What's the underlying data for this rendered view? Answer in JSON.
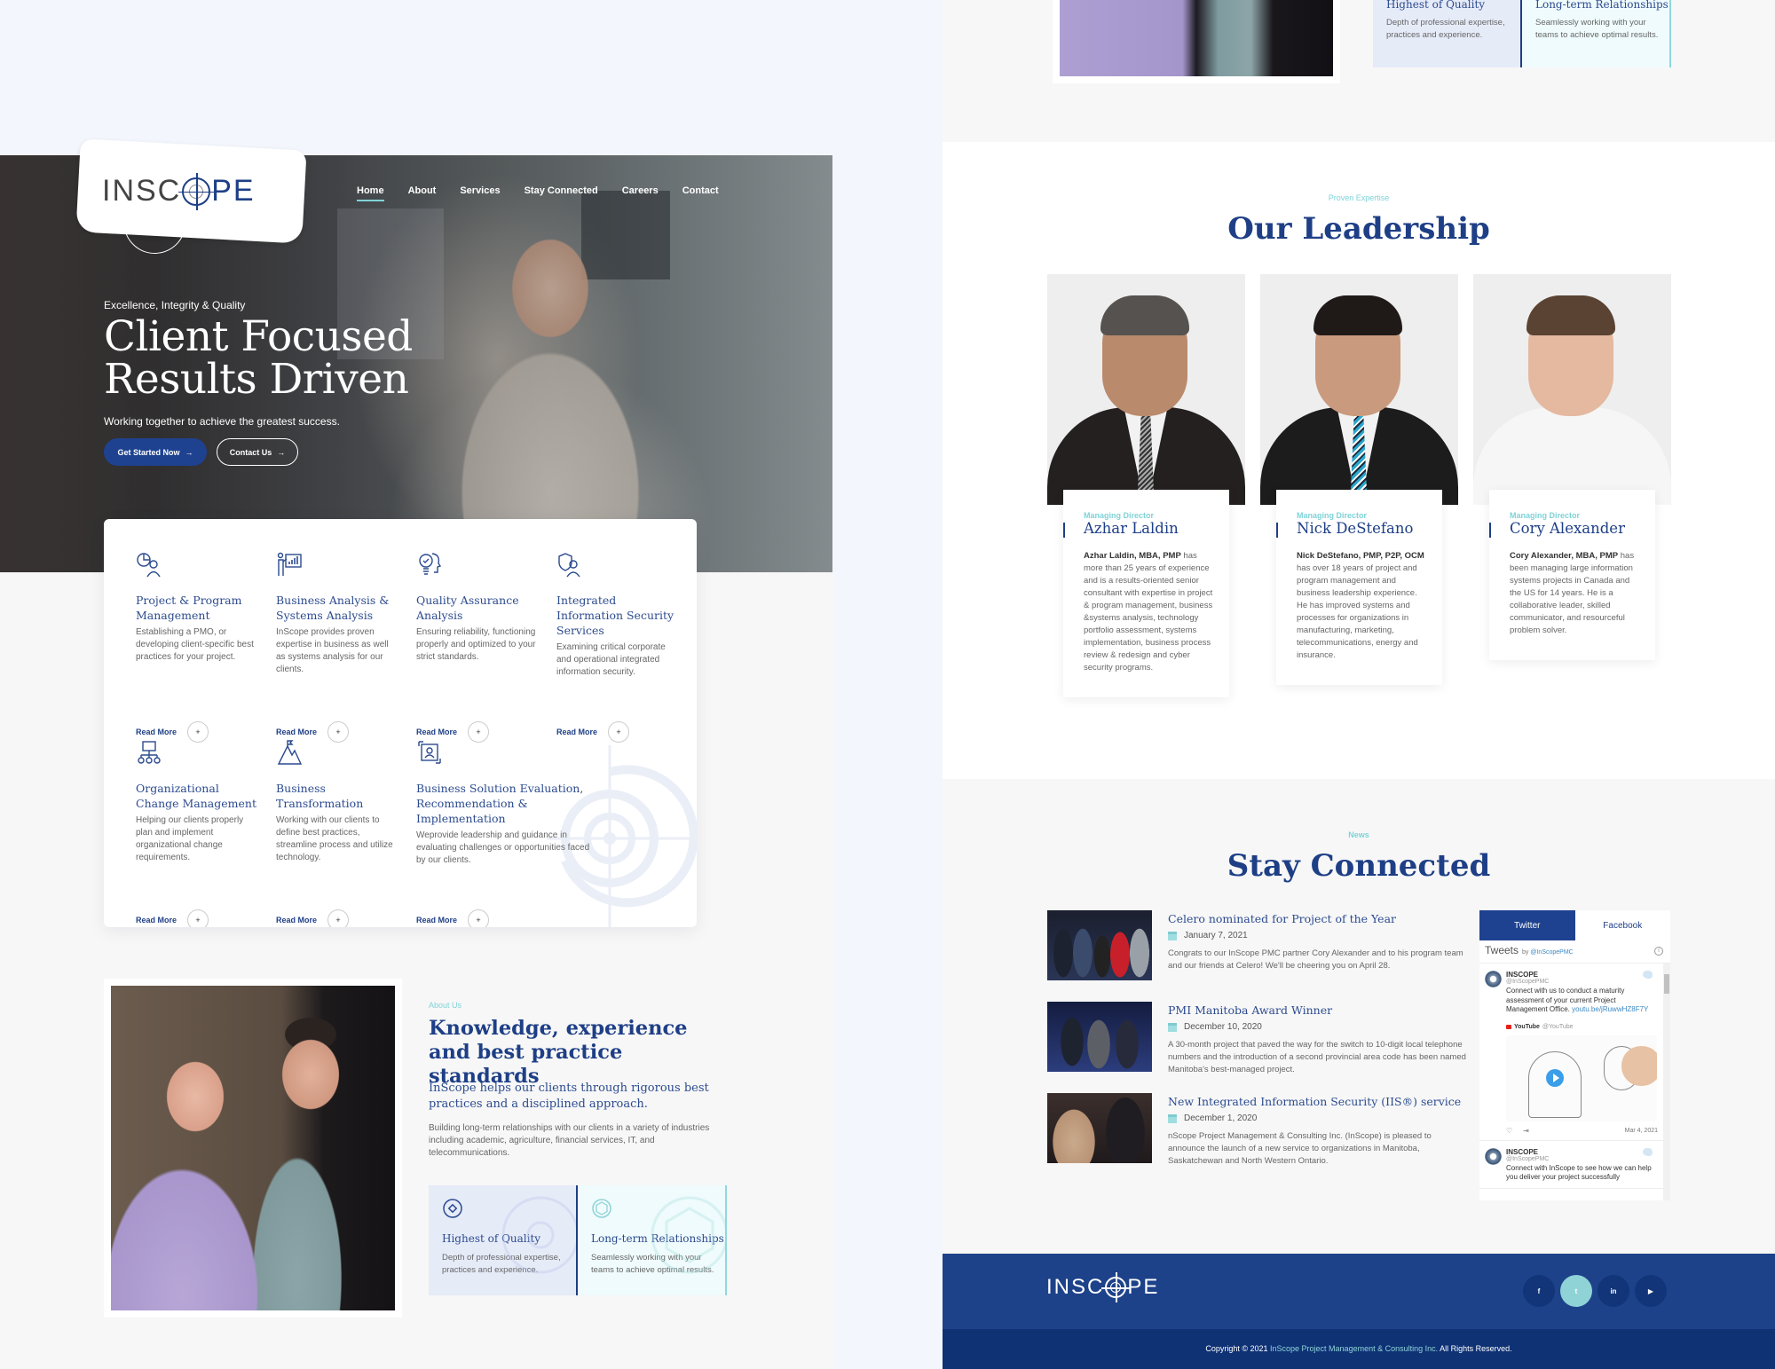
{
  "header": {
    "logo_text": {
      "left": "INSC",
      "right": "PE"
    },
    "nav": [
      {
        "label": "Home",
        "active": true
      },
      {
        "label": "About",
        "active": false
      },
      {
        "label": "Services",
        "active": false
      },
      {
        "label": "Stay Connected",
        "active": false
      },
      {
        "label": "Careers",
        "active": false
      },
      {
        "label": "Contact",
        "active": false
      }
    ]
  },
  "hero": {
    "kicker": "Excellence, Integrity & Quality",
    "title_line1": "Client Focused",
    "title_line2": "Results Driven",
    "subtitle": "Working together to achieve the greatest success.",
    "primary_button": "Get Started Now",
    "secondary_button": "Contact Us",
    "arrow_icon": "→"
  },
  "services": {
    "read_more_label": "Read More",
    "plus_icon": "+",
    "items": [
      {
        "icon": "pie-chart-person-icon",
        "title": "Project & Program Management",
        "desc": "Establishing a PMO, or developing client-specific best practices for your project."
      },
      {
        "icon": "presentation-chart-icon",
        "title": "Business Analysis & Systems Analysis",
        "desc": "InScope provides proven expertise in business as well as systems analysis for our clients."
      },
      {
        "icon": "lightbulb-head-icon",
        "title": "Quality Assurance Analysis",
        "desc": "Ensuring reliability, functioning properly and optimized to your strict standards."
      },
      {
        "icon": "shield-person-icon",
        "title": "Integrated Information Security Services",
        "desc": "Examining critical corporate and operational integrated information security."
      },
      {
        "icon": "org-chart-icon",
        "title": "Organizational Change Management",
        "desc": "Helping our clients properly plan and implement organizational change requirements."
      },
      {
        "icon": "mountain-flag-icon",
        "title": "Business Transformation",
        "desc": "Working with our clients to define best practices, streamline process and utilize technology."
      },
      {
        "icon": "person-arrows-icon",
        "title": "Business Solution Evaluation, Recommendation & Implementation",
        "desc": "Weprovide leadership and guidance in evaluating challenges or opportunities faced by our clients."
      }
    ]
  },
  "about": {
    "kicker": "About Us",
    "title": "Knowledge, experience and best practice standards",
    "lead": "InScope helps our clients through rigorous best practices and a disciplined approach.",
    "body": "Building long-term relationships with our clients in a variety of industries including academic, agriculture, financial services, IT, and telecommunications.",
    "features": [
      {
        "icon": "quality-gear-icon",
        "title": "Highest of Quality",
        "desc": "Depth of professional expertise, practices and experience."
      },
      {
        "icon": "cube-network-icon",
        "title": "Long-term Relationships",
        "desc": "Seamlessly working with your teams to achieve optimal results."
      }
    ]
  },
  "leadership": {
    "kicker": "Proven Expertise",
    "title": "Our Leadership",
    "members": [
      {
        "role": "Managing Director",
        "name": "Azhar Laldin",
        "bio_bold": "Azhar Laldin, MBA, PMP",
        "bio": " has more than 25 years of experience and is a results-oriented senior consultant with expertise in project & program management, business &systems analysis, technology portfolio assessment, systems implementation, business process review & redesign and cyber security programs."
      },
      {
        "role": "Managing Director",
        "name": "Nick DeStefano",
        "bio_bold": "Nick DeStefano, PMP, P2P, OCM",
        "bio": " has over 18 years of project and program management and business leadership experience. He has improved systems and processes for organizations in manufacturing, marketing, telecommunications, energy and insurance."
      },
      {
        "role": "Managing Director",
        "name": "Cory Alexander",
        "bio_bold": "Cory Alexander, MBA, PMP",
        "bio": " has been managing large information systems projects in Canada and the US for 14 years. He is a collaborative leader, skilled communicator, and resourceful problem solver."
      }
    ]
  },
  "news": {
    "kicker": "News",
    "title": "Stay Connected",
    "items": [
      {
        "title": "Celero nominated for Project of the Year",
        "date": "January 7, 2021",
        "desc": "Congrats to our InScope PMC partner Cory Alexander and to his program team and our friends at Celero! We'll be cheering you on April 28."
      },
      {
        "title": "PMI Manitoba Award Winner",
        "date": "December 10, 2020",
        "desc": "A 30-month project that paved the way for the switch to 10-digit local telephone numbers and the introduction of a second provincial area code has been named Manitoba's best-managed project."
      },
      {
        "title": "New Integrated Information Security (IIS®) service",
        "date": "December 1, 2020",
        "desc": "nScope Project Management & Consulting Inc. (InScope) is pleased to announce the launch of a new service to organizations in Manitoba, Saskatchewan and North Western Ontario."
      }
    ]
  },
  "social_widget": {
    "tabs": [
      {
        "label": "Twitter",
        "active": true
      },
      {
        "label": "Facebook",
        "active": false
      }
    ],
    "header_title": "Tweets",
    "header_by": "by",
    "header_handle": "@InScopePMC",
    "info_icon": "i",
    "tweets": [
      {
        "name": "INSCOPE",
        "handle": "@InScopePMC",
        "text": "Connect with us to conduct a maturity assessment of your current Project Management Office.",
        "link": "youtu.be/jRuwwHZ8F7Y",
        "embed_source": "YouTube",
        "embed_handle": "@YouTube",
        "like_icon": "♡",
        "share_icon": "⇥",
        "date": "Mar 4, 2021"
      },
      {
        "name": "INSCOPE",
        "handle": "@InScopePMC",
        "text": "Connect with InScope to see how we can help you deliver your project successfully"
      }
    ]
  },
  "footer": {
    "logo_text": {
      "left": "INSC",
      "right": "PE"
    },
    "social": [
      {
        "name": "facebook",
        "glyph": "f",
        "active": false
      },
      {
        "name": "twitter",
        "glyph": "t",
        "active": true
      },
      {
        "name": "linkedin",
        "glyph": "in",
        "active": false
      },
      {
        "name": "youtube",
        "glyph": "▶",
        "active": false
      }
    ],
    "copyright_prefix": "Copyright © 2021 ",
    "copyright_link": "InScope Project Management & Consulting Inc.",
    "copyright_suffix": " All Rights Reserved."
  },
  "colors": {
    "brand_navy": "#1e3f86",
    "accent_teal": "#7fd3d7",
    "footer_blue": "#1d4289",
    "footer_dark": "#0f3275"
  }
}
